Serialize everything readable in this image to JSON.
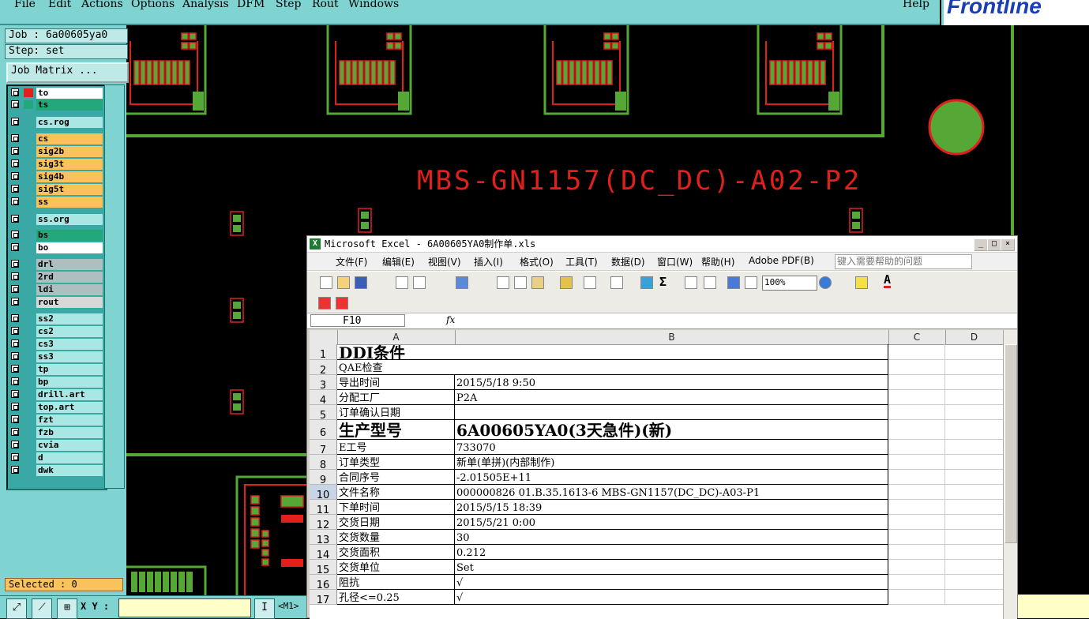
{
  "app": {
    "menu": [
      "File",
      "Edit",
      "Actions",
      "Options",
      "Analysis",
      "DFM",
      "Step",
      "Rout",
      "Windows"
    ],
    "help_label": "Help",
    "logo_text": "Frontline"
  },
  "panel": {
    "job_label": "Job : 6a00605ya0",
    "step_label": "Step: set",
    "job_matrix_label": "Job Matrix ...",
    "selected_label": "Selected : 0"
  },
  "layers": [
    {
      "name": "to",
      "color": "#ffffff"
    },
    {
      "name": "ts",
      "color": "#22a87a"
    },
    {
      "name": "cs.rog",
      "color": "#a9e7e4"
    },
    {
      "name": "cs",
      "color": "#f9c25a"
    },
    {
      "name": "sig2b",
      "color": "#f9c25a"
    },
    {
      "name": "sig3t",
      "color": "#f9c25a"
    },
    {
      "name": "sig4b",
      "color": "#f9c25a"
    },
    {
      "name": "sig5t",
      "color": "#f9c25a"
    },
    {
      "name": "ss",
      "color": "#f9c25a"
    },
    {
      "name": "ss.org",
      "color": "#a9e7e4"
    },
    {
      "name": "bs",
      "color": "#22a87a"
    },
    {
      "name": "bo",
      "color": "#ffffff"
    },
    {
      "name": "drl",
      "color": "#aebfc2"
    },
    {
      "name": "2rd",
      "color": "#aebfc2"
    },
    {
      "name": "ldi",
      "color": "#aebfc2"
    },
    {
      "name": "rout",
      "color": "#d8d8d8"
    },
    {
      "name": "ss2",
      "color": "#a9e7e4"
    },
    {
      "name": "cs2",
      "color": "#a9e7e4"
    },
    {
      "name": "cs3",
      "color": "#a9e7e4"
    },
    {
      "name": "ss3",
      "color": "#a9e7e4"
    },
    {
      "name": "tp",
      "color": "#a9e7e4"
    },
    {
      "name": "bp",
      "color": "#a9e7e4"
    },
    {
      "name": "drill.art",
      "color": "#a9e7e4"
    },
    {
      "name": "top.art",
      "color": "#a9e7e4"
    },
    {
      "name": "fzt",
      "color": "#a9e7e4"
    },
    {
      "name": "fzb",
      "color": "#a9e7e4"
    },
    {
      "name": "cvia",
      "color": "#a9e7e4"
    },
    {
      "name": "d",
      "color": "#a9e7e4"
    },
    {
      "name": "dwk",
      "color": "#a9e7e4"
    }
  ],
  "bottom": {
    "xy_label": "X Y :",
    "xy_value": "",
    "mode_label": "<M1>"
  },
  "pcb": {
    "board_text": "MBS-GN1157(DC_DC)-A02-P2"
  },
  "excel": {
    "title": "Microsoft Excel - 6A00605YA0制作单.xls",
    "menu": [
      "文件(F)",
      "编辑(E)",
      "视图(V)",
      "插入(I)",
      "格式(O)",
      "工具(T)",
      "数据(D)",
      "窗口(W)",
      "帮助(H)",
      "Adobe PDF(B)"
    ],
    "help_placeholder": "键入需要帮助的问题",
    "zoom": "100%",
    "name_box": "F10",
    "fx_label": "fx",
    "columns": [
      "A",
      "B",
      "C",
      "D"
    ],
    "rows": [
      {
        "num": "1",
        "a": "DDI条件",
        "b": ""
      },
      {
        "num": "2",
        "a": "QAE检查",
        "b": ""
      },
      {
        "num": "3",
        "a": "导出时间",
        "b": "2015/5/18 9:50"
      },
      {
        "num": "4",
        "a": "分配工厂",
        "b": "P2A"
      },
      {
        "num": "5",
        "a": "订单确认日期",
        "b": ""
      },
      {
        "num": "6",
        "a": "生产型号",
        "b": "6A00605YA0(3天急件)(新)"
      },
      {
        "num": "7",
        "a": "E工号",
        "b": "733070"
      },
      {
        "num": "8",
        "a": "订单类型",
        "b": "新单(单拼)(内部制作)"
      },
      {
        "num": "9",
        "a": "合同序号",
        "b": "-2.01505E+11"
      },
      {
        "num": "10",
        "a": "文件名称",
        "b": "000000826 01.B.35.1613-6 MBS-GN1157(DC_DC)-A03-P1"
      },
      {
        "num": "11",
        "a": "下单时间",
        "b": "2015/5/15 18:39"
      },
      {
        "num": "12",
        "a": "交货日期",
        "b": "2015/5/21 0:00"
      },
      {
        "num": "13",
        "a": "交货数量",
        "b": "30"
      },
      {
        "num": "14",
        "a": "交货面积",
        "b": "0.212"
      },
      {
        "num": "15",
        "a": "交货单位",
        "b": "Set"
      },
      {
        "num": "16",
        "a": "阻抗",
        "b": "√"
      },
      {
        "num": "17",
        "a": "孔径<=0.25",
        "b": "√"
      }
    ]
  }
}
